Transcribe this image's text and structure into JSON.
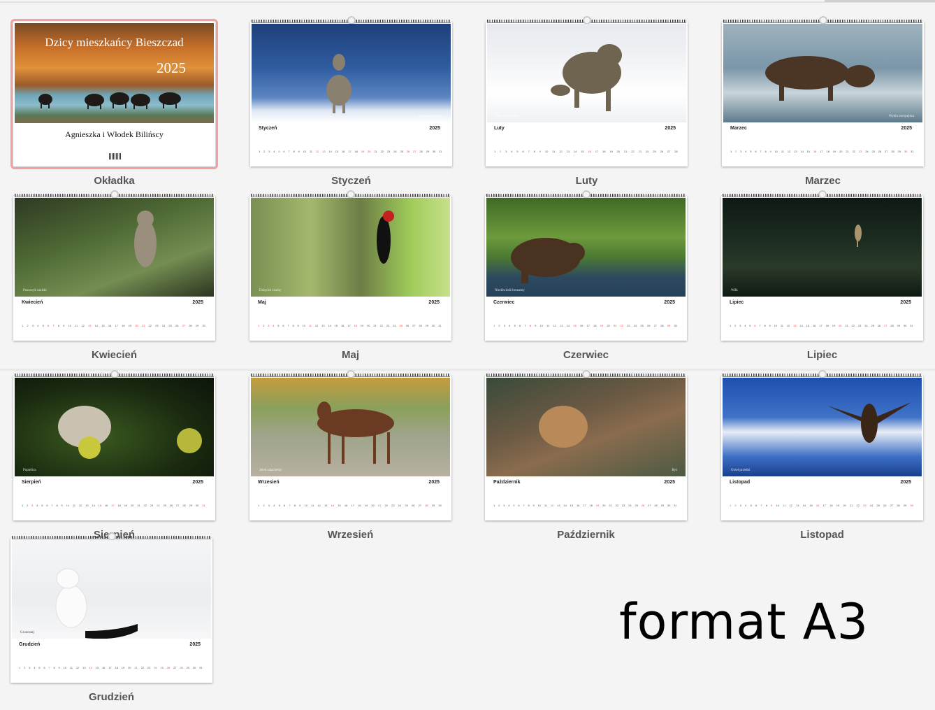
{
  "cover": {
    "title": "Dzicy mieszkańcy Bieszczad",
    "year": "2025",
    "author": "Agnieszka i Włodek Bilińscy",
    "label": "Okładka"
  },
  "year": "2025",
  "months": [
    {
      "name": "Styczeń",
      "label": "Styczeń",
      "caption": "Sarna europejska",
      "days": 31,
      "red": [
        5,
        6,
        12,
        13,
        19,
        20,
        26,
        27
      ],
      "photo_bg": "linear-gradient(180deg,#1f3f7a 0%,#2f5da0 45%,#5d86c2 75%,#dfe7f3 88%,#ffffff 100%)",
      "photo_color": "#8a8070"
    },
    {
      "name": "Luty",
      "label": "Luty",
      "caption": "Żbik europejski",
      "days": 28,
      "red": [
        2,
        9,
        16,
        23
      ],
      "photo_bg": "linear-gradient(180deg,#e6e9ee 0%,#f2f4f6 40%,#ffffff 70%,#eef1f4 100%)",
      "photo_color": "#6e6450"
    },
    {
      "name": "Marzec",
      "label": "Marzec",
      "caption": "Wydra europejska",
      "days": 31,
      "red": [
        2,
        9,
        16,
        23,
        30
      ],
      "photo_bg": "linear-gradient(180deg,#9fb2bf 0%,#7a96a8 45%,#c9d4da 70%,#5d7a8c 100%)",
      "photo_color": "#4b3626"
    },
    {
      "name": "Kwiecień",
      "label": "Kwiecień",
      "caption": "Puszczyk uralski",
      "days": 30,
      "red": [
        6,
        13,
        20,
        21,
        27
      ],
      "photo_bg": "linear-gradient(160deg,#2e3a22 0%,#4f6a35 40%,#748d52 70%,#2b351f 100%)",
      "photo_color": "#9a8f7c"
    },
    {
      "name": "Maj",
      "label": "Maj",
      "caption": "Dzięcioł czarny",
      "days": 31,
      "red": [
        1,
        3,
        4,
        11,
        18,
        25
      ],
      "photo_bg": "linear-gradient(90deg,#7a8f52 0%,#a4b86d 30%,#6d7d45 55%,#9ecb5a 80%,#c8e08a 100%)",
      "photo_color": "#111"
    },
    {
      "name": "Czerwiec",
      "label": "Czerwiec",
      "caption": "Niedźwiedź brunatny",
      "days": 30,
      "red": [
        1,
        8,
        15,
        19,
        22,
        29
      ],
      "photo_bg": "linear-gradient(180deg,#3f6b25 0%,#6d9a3c 40%,#4b7a33 60%,#2e4a5e 80%,#25405a 100%)",
      "photo_color": "#4a3220"
    },
    {
      "name": "Lipiec",
      "label": "Lipiec",
      "caption": "Wilk",
      "days": 31,
      "red": [
        6,
        13,
        20,
        27
      ],
      "photo_bg": "linear-gradient(180deg,#0e1a14 0%,#1c2b20 40%,#2a3a28 70%,#101a14 100%)",
      "photo_color": "#a9946d"
    },
    {
      "name": "Sierpień",
      "label": "Sierpień",
      "caption": "Popielica",
      "days": 31,
      "red": [
        3,
        10,
        15,
        17,
        24,
        31
      ],
      "photo_bg": "radial-gradient(ellipse at 40% 60%,#3b5a20 0%,#1a2a10 60%,#0c140a 100%)",
      "photo_color": "#c9c2b0"
    },
    {
      "name": "Wrzesień",
      "label": "Wrzesień",
      "caption": "Jeleń szlachetny",
      "days": 30,
      "red": [
        7,
        14,
        21,
        28
      ],
      "photo_bg": "linear-gradient(180deg,#c59b3e 0%,#8ba05a 30%,#9fa58c 60%,#b8b0a0 100%)",
      "photo_color": "#6b3a22"
    },
    {
      "name": "Październik",
      "label": "Październik",
      "caption": "Ryś",
      "days": 31,
      "red": [
        5,
        12,
        19,
        26
      ],
      "photo_bg": "linear-gradient(160deg,#3a4a3a 0%,#6c5a44 40%,#8a6c4e 60%,#4c5a44 100%)",
      "photo_color": "#b88a5a"
    },
    {
      "name": "Listopad",
      "label": "Listopad",
      "caption": "Orzeł przedni",
      "days": 30,
      "red": [
        1,
        2,
        9,
        11,
        16,
        23,
        30
      ],
      "photo_bg": "linear-gradient(180deg,#1f4fae 0%,#3f72c8 40%,#e8edf5 55%,#3c6fc6 80%,#1a3f8c 100%)",
      "photo_color": "#3a2616"
    },
    {
      "name": "Grudzień",
      "label": "Grudzień",
      "caption": "Gronostaj",
      "days": 31,
      "red": [
        7,
        14,
        21,
        24,
        25,
        26,
        28
      ],
      "photo_bg": "linear-gradient(180deg,#f4f5f7 0%,#ebedf0 60%,#f7f7f8 100%)",
      "photo_color": "#ffffff"
    }
  ],
  "format_text": "format A3"
}
